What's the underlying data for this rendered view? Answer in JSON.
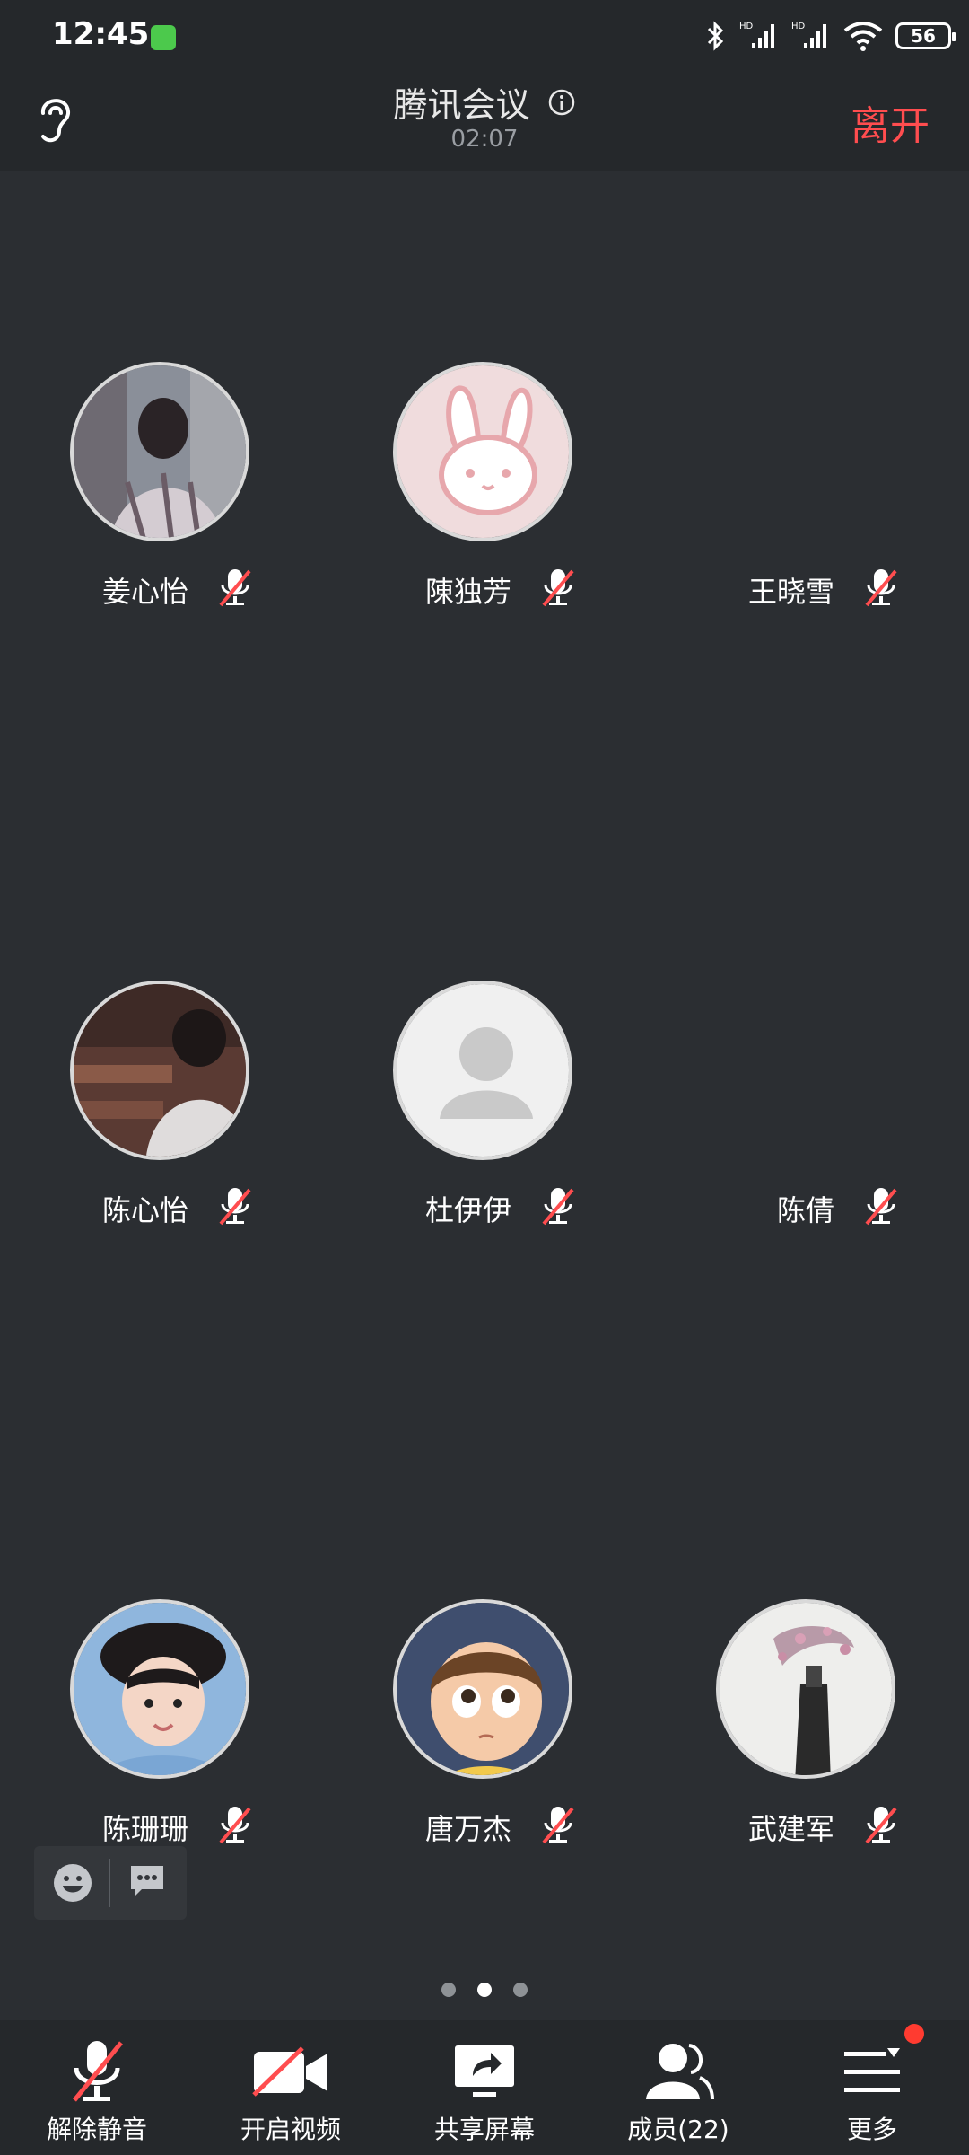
{
  "status_bar": {
    "time": "12:45",
    "battery": "56",
    "icons": [
      "app-notification-icon",
      "bluetooth-icon",
      "hd-signal-icon",
      "hd-signal-icon",
      "wifi-icon",
      "battery-icon"
    ]
  },
  "header": {
    "title": "腾讯会议",
    "duration": "02:07",
    "leave_label": "离开",
    "leave_color": "#ff4d4f"
  },
  "participants": [
    {
      "name": "姜心怡",
      "avatar": "photo",
      "muted": true
    },
    {
      "name": "陳独芳",
      "avatar": "bunny",
      "muted": true
    },
    {
      "name": "王晓雪",
      "avatar": "none",
      "muted": true
    },
    {
      "name": "陈心怡",
      "avatar": "photo",
      "muted": true
    },
    {
      "name": "杜伊伊",
      "avatar": "default",
      "muted": true
    },
    {
      "name": "陈倩",
      "avatar": "none",
      "muted": true
    },
    {
      "name": "陈珊珊",
      "avatar": "photo",
      "muted": true
    },
    {
      "name": "唐万杰",
      "avatar": "cartoon",
      "muted": true
    },
    {
      "name": "武建军",
      "avatar": "photo",
      "muted": true
    }
  ],
  "pager": {
    "pages": 3,
    "current": 2
  },
  "toolbar": {
    "items": [
      {
        "label": "解除静音",
        "icon": "mic-off-icon"
      },
      {
        "label": "开启视频",
        "icon": "video-off-icon"
      },
      {
        "label": "共享屏幕",
        "icon": "share-screen-icon"
      },
      {
        "label": "成员(22)",
        "icon": "members-icon"
      },
      {
        "label": "更多",
        "icon": "more-menu-icon"
      }
    ]
  },
  "colors": {
    "background": "#2b2e32",
    "bar": "#25282b",
    "muted_slash": "#ff4d4f"
  }
}
